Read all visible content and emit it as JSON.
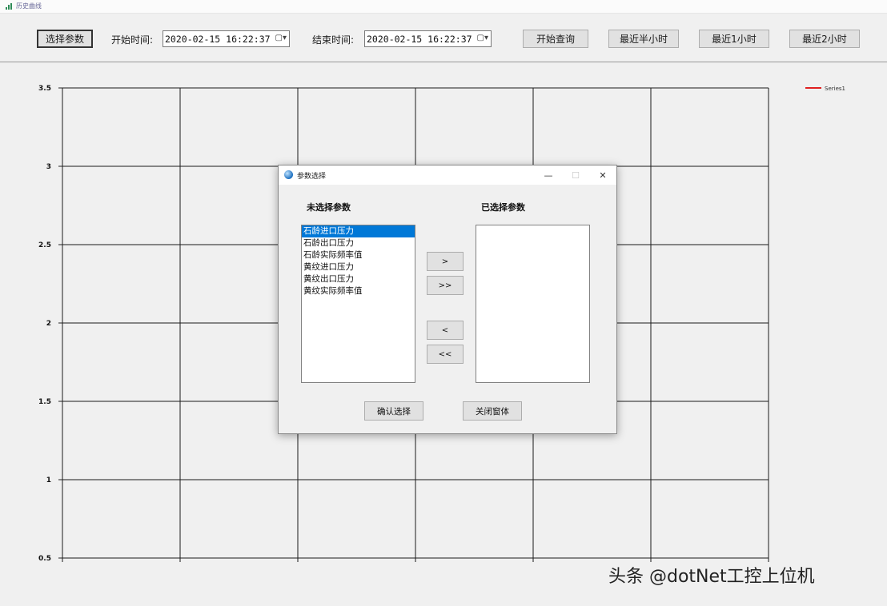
{
  "window": {
    "title": "历史曲线"
  },
  "toolbar": {
    "select_params_label": "选择参数",
    "start_time_label": "开始时间:",
    "start_time_value": "2020-02-15  16:22:37",
    "end_time_label": "结束时间:",
    "end_time_value": "2020-02-15  16:22:37",
    "query_label": "开始查询",
    "half_hour_label": "最近半小时",
    "one_hour_label": "最近1小时",
    "two_hour_label": "最近2小时",
    "calendar_glyph": "▢▾"
  },
  "chart_data": {
    "type": "line",
    "ylim": [
      0.5,
      3.5
    ],
    "yticks": [
      "3.5",
      "3",
      "2.5",
      "2",
      "1.5",
      "1",
      "0.5"
    ],
    "series": [
      {
        "name": "Series1",
        "values": []
      }
    ],
    "legend_position": "top-right",
    "grid": true,
    "series_color": "#e02020"
  },
  "dialog": {
    "title": "参数选择",
    "minimize_glyph": "—",
    "maximize_glyph": "☐",
    "close_glyph": "✕",
    "unselected_label": "未选择参数",
    "selected_label": "已选择参数",
    "unselected_items": [
      "石龄进口压力",
      "石龄出口压力",
      "石龄实际频率值",
      "黄纹进口压力",
      "黄纹出口压力",
      "黄纹实际频率值"
    ],
    "selected_index": 0,
    "selected_items": [],
    "add_one": ">",
    "add_all": ">>",
    "remove_one": "<",
    "remove_all": "<<",
    "confirm_label": "确认选择",
    "close_label": "关闭窗体"
  },
  "watermark": {
    "text": "头条 @dotNet工控上位机"
  },
  "colors": {
    "accent": "#0078d7",
    "grid": "#1a1a1a"
  }
}
